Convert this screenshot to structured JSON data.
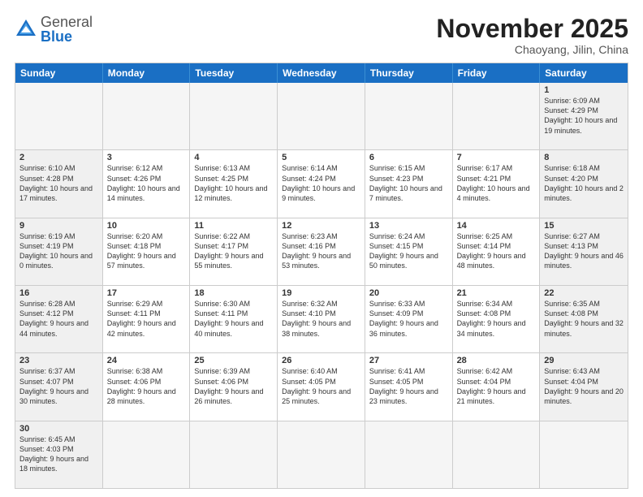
{
  "header": {
    "logo_general": "General",
    "logo_blue": "Blue",
    "month_title": "November 2025",
    "location": "Chaoyang, Jilin, China"
  },
  "days_of_week": [
    "Sunday",
    "Monday",
    "Tuesday",
    "Wednesday",
    "Thursday",
    "Friday",
    "Saturday"
  ],
  "weeks": [
    [
      {
        "day": "",
        "info": "",
        "empty": true
      },
      {
        "day": "",
        "info": "",
        "empty": true
      },
      {
        "day": "",
        "info": "",
        "empty": true
      },
      {
        "day": "",
        "info": "",
        "empty": true
      },
      {
        "day": "",
        "info": "",
        "empty": true
      },
      {
        "day": "",
        "info": "",
        "empty": true
      },
      {
        "day": "1",
        "info": "Sunrise: 6:09 AM\nSunset: 4:29 PM\nDaylight: 10 hours\nand 19 minutes.",
        "weekend": true
      }
    ],
    [
      {
        "day": "2",
        "info": "Sunrise: 6:10 AM\nSunset: 4:28 PM\nDaylight: 10 hours\nand 17 minutes.",
        "weekend": true
      },
      {
        "day": "3",
        "info": "Sunrise: 6:12 AM\nSunset: 4:26 PM\nDaylight: 10 hours\nand 14 minutes."
      },
      {
        "day": "4",
        "info": "Sunrise: 6:13 AM\nSunset: 4:25 PM\nDaylight: 10 hours\nand 12 minutes."
      },
      {
        "day": "5",
        "info": "Sunrise: 6:14 AM\nSunset: 4:24 PM\nDaylight: 10 hours\nand 9 minutes."
      },
      {
        "day": "6",
        "info": "Sunrise: 6:15 AM\nSunset: 4:23 PM\nDaylight: 10 hours\nand 7 minutes."
      },
      {
        "day": "7",
        "info": "Sunrise: 6:17 AM\nSunset: 4:21 PM\nDaylight: 10 hours\nand 4 minutes."
      },
      {
        "day": "8",
        "info": "Sunrise: 6:18 AM\nSunset: 4:20 PM\nDaylight: 10 hours\nand 2 minutes.",
        "weekend": true
      }
    ],
    [
      {
        "day": "9",
        "info": "Sunrise: 6:19 AM\nSunset: 4:19 PM\nDaylight: 10 hours\nand 0 minutes.",
        "weekend": true
      },
      {
        "day": "10",
        "info": "Sunrise: 6:20 AM\nSunset: 4:18 PM\nDaylight: 9 hours\nand 57 minutes."
      },
      {
        "day": "11",
        "info": "Sunrise: 6:22 AM\nSunset: 4:17 PM\nDaylight: 9 hours\nand 55 minutes."
      },
      {
        "day": "12",
        "info": "Sunrise: 6:23 AM\nSunset: 4:16 PM\nDaylight: 9 hours\nand 53 minutes."
      },
      {
        "day": "13",
        "info": "Sunrise: 6:24 AM\nSunset: 4:15 PM\nDaylight: 9 hours\nand 50 minutes."
      },
      {
        "day": "14",
        "info": "Sunrise: 6:25 AM\nSunset: 4:14 PM\nDaylight: 9 hours\nand 48 minutes."
      },
      {
        "day": "15",
        "info": "Sunrise: 6:27 AM\nSunset: 4:13 PM\nDaylight: 9 hours\nand 46 minutes.",
        "weekend": true
      }
    ],
    [
      {
        "day": "16",
        "info": "Sunrise: 6:28 AM\nSunset: 4:12 PM\nDaylight: 9 hours\nand 44 minutes.",
        "weekend": true
      },
      {
        "day": "17",
        "info": "Sunrise: 6:29 AM\nSunset: 4:11 PM\nDaylight: 9 hours\nand 42 minutes."
      },
      {
        "day": "18",
        "info": "Sunrise: 6:30 AM\nSunset: 4:11 PM\nDaylight: 9 hours\nand 40 minutes."
      },
      {
        "day": "19",
        "info": "Sunrise: 6:32 AM\nSunset: 4:10 PM\nDaylight: 9 hours\nand 38 minutes."
      },
      {
        "day": "20",
        "info": "Sunrise: 6:33 AM\nSunset: 4:09 PM\nDaylight: 9 hours\nand 36 minutes."
      },
      {
        "day": "21",
        "info": "Sunrise: 6:34 AM\nSunset: 4:08 PM\nDaylight: 9 hours\nand 34 minutes."
      },
      {
        "day": "22",
        "info": "Sunrise: 6:35 AM\nSunset: 4:08 PM\nDaylight: 9 hours\nand 32 minutes.",
        "weekend": true
      }
    ],
    [
      {
        "day": "23",
        "info": "Sunrise: 6:37 AM\nSunset: 4:07 PM\nDaylight: 9 hours\nand 30 minutes.",
        "weekend": true
      },
      {
        "day": "24",
        "info": "Sunrise: 6:38 AM\nSunset: 4:06 PM\nDaylight: 9 hours\nand 28 minutes."
      },
      {
        "day": "25",
        "info": "Sunrise: 6:39 AM\nSunset: 4:06 PM\nDaylight: 9 hours\nand 26 minutes."
      },
      {
        "day": "26",
        "info": "Sunrise: 6:40 AM\nSunset: 4:05 PM\nDaylight: 9 hours\nand 25 minutes."
      },
      {
        "day": "27",
        "info": "Sunrise: 6:41 AM\nSunset: 4:05 PM\nDaylight: 9 hours\nand 23 minutes."
      },
      {
        "day": "28",
        "info": "Sunrise: 6:42 AM\nSunset: 4:04 PM\nDaylight: 9 hours\nand 21 minutes."
      },
      {
        "day": "29",
        "info": "Sunrise: 6:43 AM\nSunset: 4:04 PM\nDaylight: 9 hours\nand 20 minutes.",
        "weekend": true
      }
    ],
    [
      {
        "day": "30",
        "info": "Sunrise: 6:45 AM\nSunset: 4:03 PM\nDaylight: 9 hours\nand 18 minutes.",
        "weekend": true
      },
      {
        "day": "",
        "info": "",
        "empty": true
      },
      {
        "day": "",
        "info": "",
        "empty": true
      },
      {
        "day": "",
        "info": "",
        "empty": true
      },
      {
        "day": "",
        "info": "",
        "empty": true
      },
      {
        "day": "",
        "info": "",
        "empty": true
      },
      {
        "day": "",
        "info": "",
        "empty": true
      }
    ]
  ]
}
